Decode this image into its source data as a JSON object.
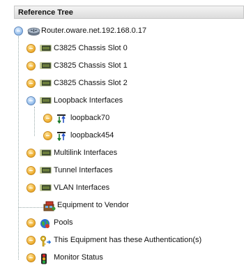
{
  "header": {
    "title": "Reference Tree"
  },
  "tree": {
    "root": {
      "label": "Router.oware.net.192.168.0.17",
      "icon": "router-icon",
      "state": "expanded"
    },
    "items": [
      {
        "label": "C3825 Chassis Slot 0",
        "icon": "chassis-card-icon",
        "state": "collapsed"
      },
      {
        "label": "C3825 Chassis Slot 1",
        "icon": "chassis-card-icon",
        "state": "collapsed"
      },
      {
        "label": "C3825 Chassis Slot 2",
        "icon": "chassis-card-icon",
        "state": "collapsed"
      },
      {
        "label": "Loopback Interfaces",
        "icon": "chassis-card-icon",
        "state": "expanded",
        "children": [
          {
            "label": "loopback70",
            "icon": "interface-arrows-icon",
            "state": "collapsed"
          },
          {
            "label": "loopback454",
            "icon": "interface-arrows-icon",
            "state": "collapsed"
          }
        ]
      },
      {
        "label": "Multilink Interfaces",
        "icon": "chassis-card-icon",
        "state": "collapsed"
      },
      {
        "label": "Tunnel Interfaces",
        "icon": "chassis-card-icon",
        "state": "collapsed"
      },
      {
        "label": "VLAN Interfaces",
        "icon": "chassis-card-icon",
        "state": "collapsed"
      },
      {
        "label": "Equipment to Vendor",
        "icon": "vendor-icon",
        "state": "leaf"
      },
      {
        "label": "Pools",
        "icon": "globe-icon",
        "state": "collapsed"
      },
      {
        "label": "This Equipment has these Authentication(s)",
        "icon": "key-icon",
        "state": "collapsed"
      },
      {
        "label": "Monitor Status",
        "icon": "traffic-light-icon",
        "state": "collapsed"
      }
    ]
  }
}
